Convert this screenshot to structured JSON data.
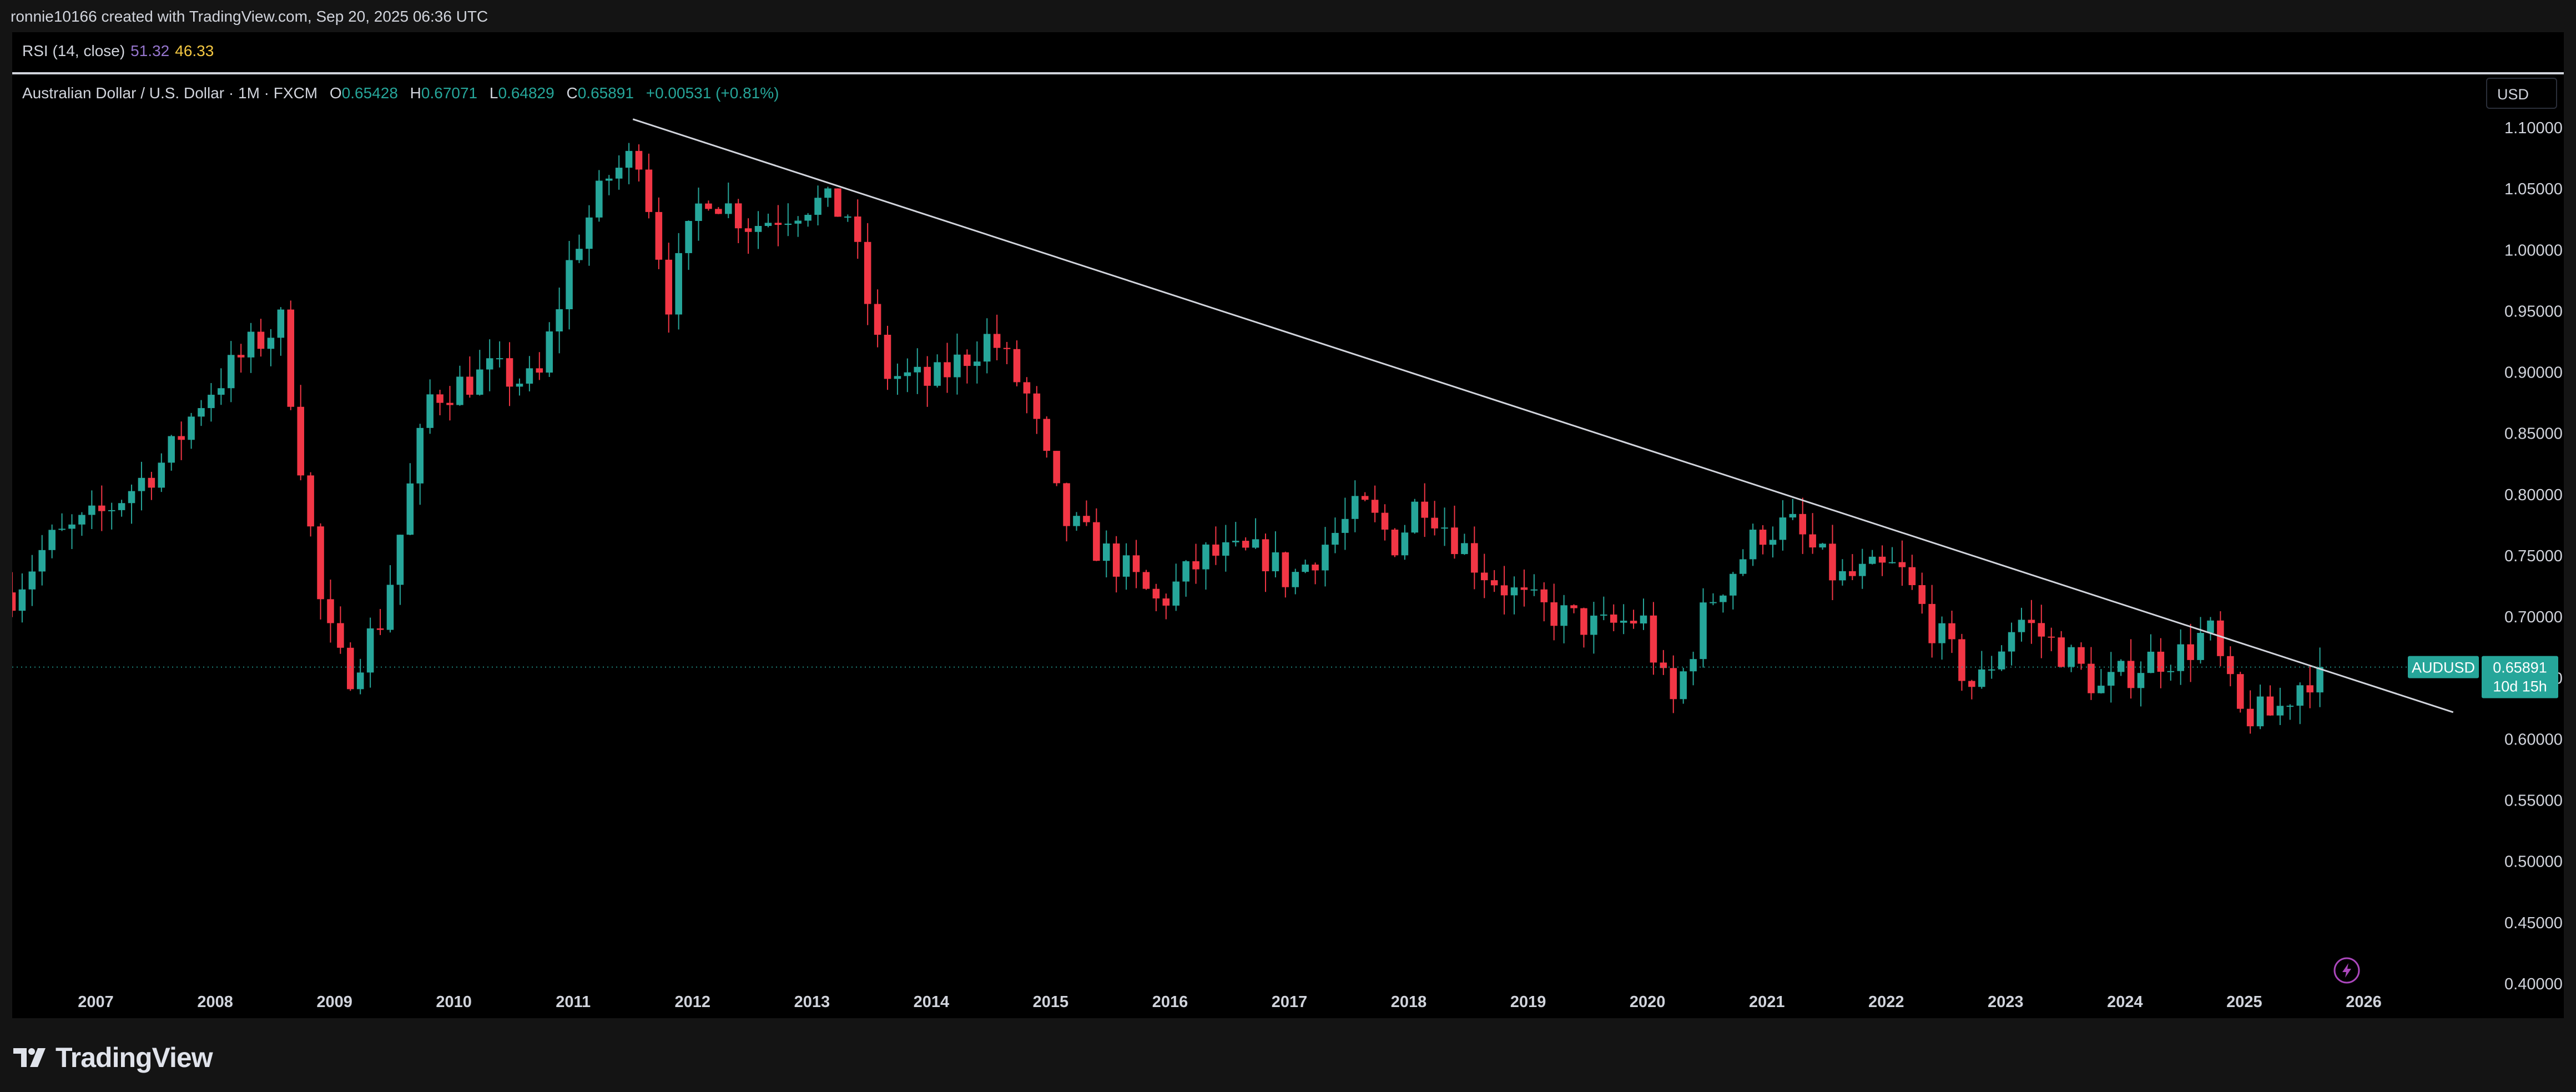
{
  "attribution": "ronnie10166 created with TradingView.com, Sep 20, 2025 06:36 UTC",
  "rsi": {
    "label": "RSI (14, close)",
    "value1": "51.32",
    "value2": "46.33",
    "value1_color": "#9575cd",
    "value2_color": "#f5c842"
  },
  "symbol": {
    "name": "Australian Dollar / U.S. Dollar · 1M · FXCM",
    "o_label": "O",
    "o": "0.65428",
    "h_label": "H",
    "h": "0.67071",
    "l_label": "L",
    "l": "0.64829",
    "c_label": "C",
    "c": "0.65891",
    "change": "+0.00531 (+0.81%)"
  },
  "currency_button": "USD",
  "price_tag": {
    "symbol": "AUDUSD",
    "price": "0.65891",
    "countdown": "10d 15h"
  },
  "footer_logo": "TradingView",
  "colors": {
    "up": "#26a69a",
    "down": "#f23645",
    "background": "#000000",
    "trendline": "#d1d4dc"
  },
  "icons": [
    "flash-icon",
    "tradingview-logo-icon"
  ],
  "chart_data": {
    "type": "candlestick",
    "interval": "1M",
    "ylim": [
      0.38,
      1.13
    ],
    "yticks": [
      "1.10000",
      "1.05000",
      "1.00000",
      "0.95000",
      "0.90000",
      "0.85000",
      "0.80000",
      "0.75000",
      "0.70000",
      "0.65000",
      "0.60000",
      "0.55000",
      "0.50000",
      "0.45000",
      "0.40000"
    ],
    "xlim": [
      2006.3,
      2026.9
    ],
    "xticks": [
      "2007",
      "2008",
      "2009",
      "2010",
      "2011",
      "2012",
      "2013",
      "2014",
      "2015",
      "2016",
      "2017",
      "2018",
      "2019",
      "2020",
      "2021",
      "2022",
      "2023",
      "2024",
      "2025",
      "2026"
    ],
    "last_price": 0.65891,
    "trendline": {
      "start": [
        2011.5,
        1.107
      ],
      "end": [
        2026.75,
        0.622
      ]
    },
    "anchors": [
      [
        2006.3,
        0.72
      ],
      [
        2006.6,
        0.76
      ],
      [
        2007.0,
        0.78
      ],
      [
        2007.6,
        0.83
      ],
      [
        2007.9,
        0.88
      ],
      [
        2008.3,
        0.92
      ],
      [
        2008.55,
        0.94
      ],
      [
        2008.7,
        0.84
      ],
      [
        2008.9,
        0.7
      ],
      [
        2009.1,
        0.65
      ],
      [
        2009.4,
        0.7
      ],
      [
        2009.8,
        0.88
      ],
      [
        2010.3,
        0.9
      ],
      [
        2010.7,
        0.89
      ],
      [
        2011.0,
        1.0
      ],
      [
        2011.3,
        1.06
      ],
      [
        2011.55,
        1.08
      ],
      [
        2011.8,
        0.96
      ],
      [
        2012.1,
        1.05
      ],
      [
        2012.5,
        1.02
      ],
      [
        2013.0,
        1.04
      ],
      [
        2013.3,
        1.03
      ],
      [
        2013.6,
        0.9
      ],
      [
        2014.0,
        0.89
      ],
      [
        2014.5,
        0.93
      ],
      [
        2014.8,
        0.88
      ],
      [
        2015.1,
        0.78
      ],
      [
        2015.6,
        0.74
      ],
      [
        2015.9,
        0.71
      ],
      [
        2016.3,
        0.75
      ],
      [
        2016.8,
        0.75
      ],
      [
        2017.0,
        0.73
      ],
      [
        2017.6,
        0.79
      ],
      [
        2017.9,
        0.76
      ],
      [
        2018.1,
        0.8
      ],
      [
        2018.6,
        0.74
      ],
      [
        2019.0,
        0.71
      ],
      [
        2019.6,
        0.69
      ],
      [
        2019.95,
        0.7
      ],
      [
        2020.2,
        0.625
      ],
      [
        2020.5,
        0.71
      ],
      [
        2020.95,
        0.77
      ],
      [
        2021.2,
        0.775
      ],
      [
        2021.6,
        0.73
      ],
      [
        2022.1,
        0.74
      ],
      [
        2022.4,
        0.69
      ],
      [
        2022.75,
        0.64
      ],
      [
        2023.1,
        0.7
      ],
      [
        2023.5,
        0.67
      ],
      [
        2023.8,
        0.64
      ],
      [
        2024.2,
        0.665
      ],
      [
        2024.5,
        0.67
      ],
      [
        2024.7,
        0.69
      ],
      [
        2024.95,
        0.62
      ],
      [
        2025.25,
        0.62
      ],
      [
        2025.5,
        0.65
      ],
      [
        2025.67,
        0.6589
      ]
    ]
  }
}
